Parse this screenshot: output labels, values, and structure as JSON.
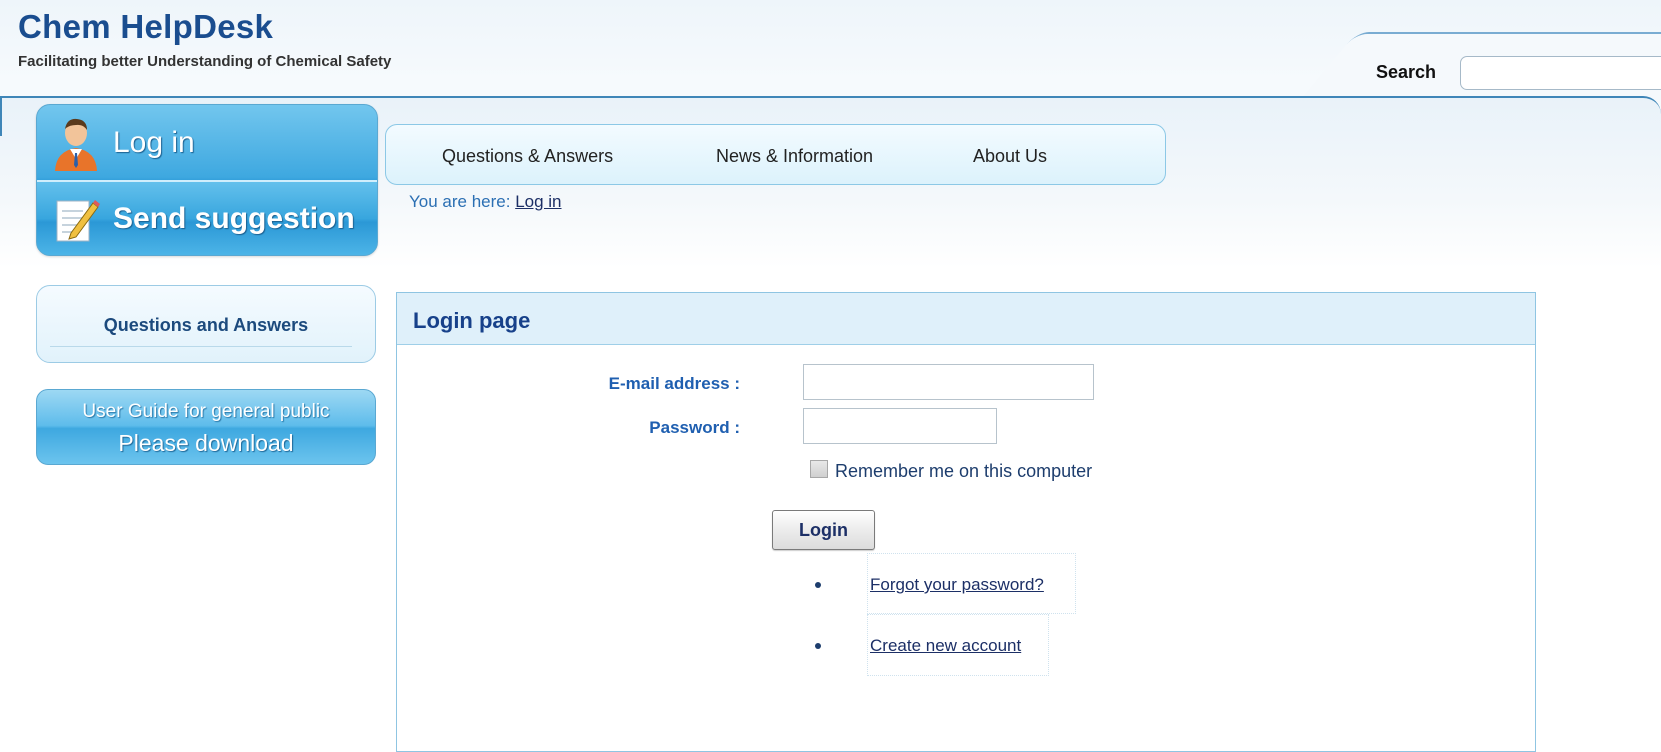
{
  "header": {
    "title": "Chem HelpDesk",
    "tagline": "Facilitating better Understanding of Chemical Safety",
    "search_label": "Search",
    "search_value": ""
  },
  "left_buttons": {
    "login": "Log in",
    "suggestion": "Send suggestion"
  },
  "nav": {
    "items": [
      {
        "label": "Questions & Answers"
      },
      {
        "label": "News & Information"
      },
      {
        "label": "About Us"
      }
    ]
  },
  "breadcrumb": {
    "prefix": "You are here:",
    "current": "Log in"
  },
  "sidebar": {
    "qa_link": "Questions and Answers",
    "guide_line1": "User Guide for general public",
    "guide_line2": "Please download"
  },
  "login_form": {
    "title": "Login page",
    "email_label": "E-mail address :",
    "email_value": "",
    "password_label": "Password :",
    "password_value": "",
    "remember_label": "Remember me on this computer",
    "remember_checked": false,
    "submit_label": "Login",
    "forgot_link": "Forgot your password?",
    "create_link": "Create new account"
  },
  "colors": {
    "brand": "#1a4d8f",
    "accent": "#3ea8e0",
    "link": "#1c2f66",
    "label": "#1f5fb0"
  },
  "icons": {
    "login": "user-icon",
    "suggestion": "edit-note-icon"
  }
}
